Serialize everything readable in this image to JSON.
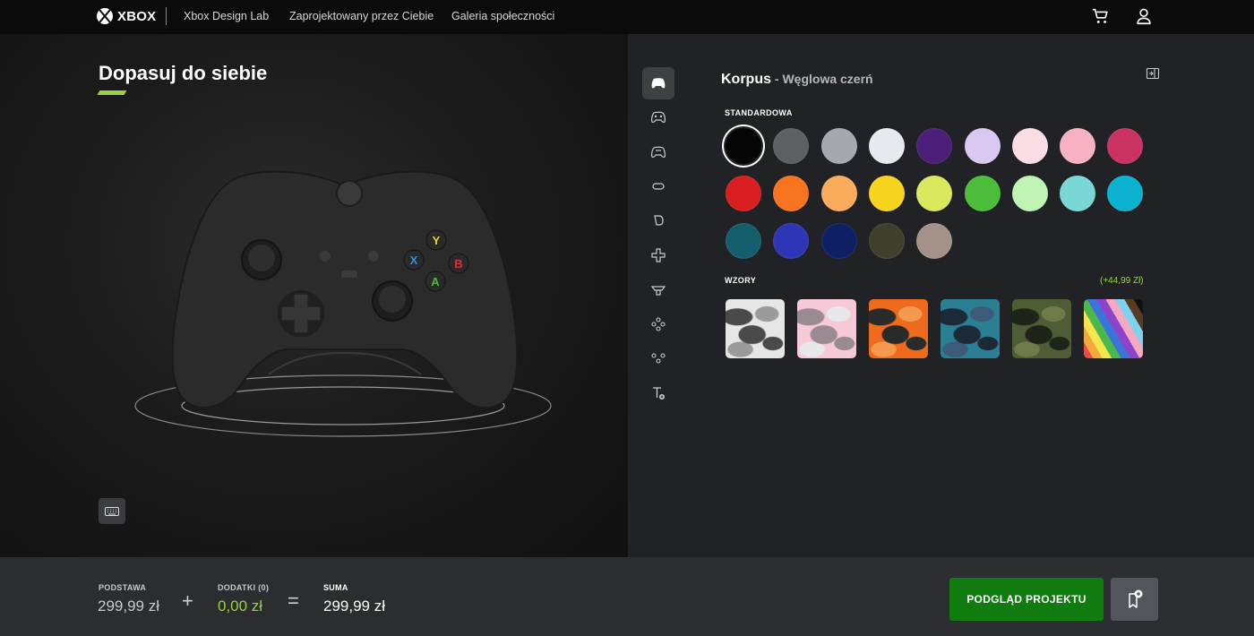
{
  "nav": {
    "brand": "XBOX",
    "links": [
      "Xbox Design Lab",
      "Zaprojektowany przez Ciebie",
      "Galeria społeczności"
    ]
  },
  "stage": {
    "title": "Dopasuj do siebie"
  },
  "panel": {
    "heading": "Korpus",
    "heading_sep": " - ",
    "subheading": "Węglowa czerń",
    "standard_label": "STANDARDOWA",
    "patterns_label": "WZORY",
    "patterns_price": "(+44,99 Zł)",
    "tools": [
      "controller-body",
      "controller-back",
      "controller-grips",
      "bumpers",
      "triggers",
      "d-pad",
      "thumbsticks",
      "abxy-buttons",
      "view-menu-buttons",
      "engraving"
    ],
    "swatches": [
      {
        "color": "#050505",
        "selected": true
      },
      {
        "color": "#5d5f62"
      },
      {
        "color": "#a5a9ad"
      },
      {
        "color": "#e6eaee"
      },
      {
        "color": "#4b1f78"
      },
      {
        "color": "#d8c8f2"
      },
      {
        "color": "#f9dde3"
      },
      {
        "color": "#f6b1c3"
      },
      {
        "color": "#c93263"
      },
      {
        "color": "#d81e20"
      },
      {
        "color": "#f7731f"
      },
      {
        "color": "#fbab5c"
      },
      {
        "color": "#f7d51f"
      },
      {
        "color": "#d9e85c"
      },
      {
        "color": "#4bbd3a"
      },
      {
        "color": "#bff3b1"
      },
      {
        "color": "#79d7d6"
      },
      {
        "color": "#0bb2d0"
      },
      {
        "color": "#145d6c"
      },
      {
        "color": "#2e35b5"
      },
      {
        "color": "#0f1f63"
      },
      {
        "color": "#3f402c"
      },
      {
        "color": "#a4928a"
      }
    ],
    "patterns": [
      {
        "name": "arctic-camo",
        "colors": [
          "#e6e6e6",
          "#9a9a9a",
          "#4a4a4a"
        ]
      },
      {
        "name": "pink-camo",
        "colors": [
          "#f6c9d6",
          "#e8e8ea",
          "#9a8a92"
        ]
      },
      {
        "name": "orange-camo",
        "colors": [
          "#ee6a1c",
          "#f49a4e",
          "#2a2a2a"
        ]
      },
      {
        "name": "blue-camo",
        "colors": [
          "#2b7f92",
          "#3c5a7a",
          "#1c2a38"
        ]
      },
      {
        "name": "forest-camo",
        "colors": [
          "#4f5d34",
          "#6f7c4a",
          "#1f2418"
        ]
      },
      {
        "name": "pride-stripes",
        "colors": [
          "#e94b4b",
          "#f2a93b",
          "#f6e64d",
          "#4ab84a",
          "#3a73d9",
          "#8e44c9",
          "#f5a9c1",
          "#7dd3ee",
          "#5a3a22",
          "#111111"
        ]
      }
    ]
  },
  "pricing": {
    "base_label": "PODSTAWA",
    "base_value": "299,99 zł",
    "plus": "+",
    "addons_label": "DODATKI (0)",
    "addons_value": "0,00 zł",
    "equals": "=",
    "total_label": "SUMA",
    "total_value": "299,99 zł",
    "addons_color": "#9bd33c"
  },
  "actions": {
    "preview_label": "PODGLĄD PROJEKTU"
  }
}
